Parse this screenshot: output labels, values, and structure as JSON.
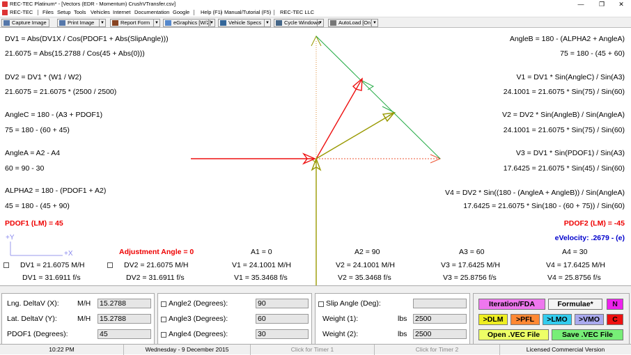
{
  "window": {
    "title": "REC-TEC Platinum* - [Vectors (EDR - Momentum)  CrushVTransfer.csv]",
    "minimize": "—",
    "restore": "❐",
    "close": "✕"
  },
  "menu": [
    "REC-TEC",
    "Files",
    "Setup",
    "Tools",
    "Vehicles",
    "Internet",
    "Documentation",
    "Google",
    "Help (F1)",
    "Manual/Tutorial (F5)",
    "REC-TEC LLC"
  ],
  "toolbar": {
    "capture": "Capture Image",
    "print": "Print Image",
    "report": "Report Form",
    "egraphics": "eGraphics [W/2]",
    "specs": "Vehicle Specs",
    "cycle": "Cycle Windows",
    "autoload": "AutoLoad [On]"
  },
  "formulas_left": [
    "DV1 = Abs(DV1X / Cos(PDOF1 + Abs(SlipAngle)))",
    "21.6075 = Abs(15.2788 / Cos(45 + Abs(0)))",
    "DV2 = DV1 * (W1 / W2)",
    "21.6075 = 21.6075 * (2500 / 2500)",
    "AngleC = 180 - (A3 + PDOF1)",
    "75 = 180 - (60 + 45)",
    "AngleA = A2 - A4",
    "60 = 90 - 30",
    "ALPHA2 = 180 - (PDOF1 + A2)",
    "45 = 180 - (45 + 90)"
  ],
  "formulas_right": [
    "AngleB = 180 - (ALPHA2 + AngleA)",
    "75 = 180 - (45 + 60)",
    "V1 = DV1 * Sin(AngleC) / Sin(A3)",
    "24.1001 = 21.6075 * Sin(75) / Sin(60)",
    "V2 = DV2 * Sin(AngleB) / Sin(AngleA)",
    "24.1001 = 21.6075 * Sin(75) / Sin(60)",
    "V3 = DV1 * Sin(PDOF1) / Sin(A3)",
    "17.6425 = 21.6075 * Sin(45) / Sin(60)",
    "V4 = DV2 * Sin((180 - (AngleA + AngleB)) / Sin(AngleA)",
    "17.6425 = 21.6075 * Sin(180 - (60 + 75)) / Sin(60)"
  ],
  "pdof1": "PDOF1 (LM) = 45",
  "pdof2": "PDOF2 (LM) = -45",
  "evelocity": "eVelocity:  .2679  -  (e)",
  "axis": {
    "y": "+Y",
    "x": "+X"
  },
  "adjustment": "Adjustment Angle = 0",
  "angles": [
    "A1 = 0",
    "A2 = 90",
    "A3 = 60",
    "A4 = 30"
  ],
  "results_mh": [
    "DV1 = 21.6075  M/H",
    "DV2 = 21.6075  M/H",
    "V1 = 24.1001  M/H",
    "V2 = 24.1001  M/H",
    "V3 = 17.6425  M/H",
    "V4 = 17.6425  M/H"
  ],
  "results_fs": [
    "DV1 = 31.6911  f/s",
    "DV2 = 31.6911  f/s",
    "V1 = 35.3468  f/s",
    "V2 = 35.3468  f/s",
    "V3 = 25.8756  f/s",
    "V4 = 25.8756  f/s"
  ],
  "vectors": {
    "colors": {
      "red": "#ee1111",
      "olive": "#999900",
      "green": "#22aa44",
      "dash": "#ee5533"
    }
  },
  "inputs": {
    "lng_label": "Lng. DeltaV (X):",
    "lng_unit": "M/H",
    "lng_value": "15.2788",
    "lat_label": "Lat. DeltaV (Y):",
    "lat_unit": "M/H",
    "lat_value": "15.2788",
    "pdof_label": "PDOF1 (Degrees):",
    "pdof_value": "45",
    "angle2_label": "Angle2 (Degrees):",
    "angle2_value": "90",
    "angle3_label": "Angle3 (Degrees):",
    "angle3_value": "60",
    "angle4_label": "Angle4 (Degrees):",
    "angle4_value": "30",
    "slip_label": "Slip Angle (Deg):",
    "slip_value": "",
    "w1_label": "Weight (1):",
    "w1_unit": "lbs",
    "w1_value": "2500",
    "w2_label": "Weight (2):",
    "w2_unit": "lbs",
    "w2_value": "2500"
  },
  "buttons": {
    "iteration": "Iteration/FDA",
    "formulae": "Formulae*",
    "n": "N",
    "dlm": ">DLM",
    "pfl": ">PFL",
    "lmo": ">LMO",
    "vmo": ">VMO",
    "c": "C",
    "open": "Open  .VEC File",
    "save": "Save  .VEC File"
  },
  "status": {
    "time": "10:22 PM",
    "date": "Wednesday  -  9 December 2015",
    "timer1": "Click for Timer 1",
    "timer2": "Click for Timer 2",
    "license": "Licensed Commercial Version"
  }
}
